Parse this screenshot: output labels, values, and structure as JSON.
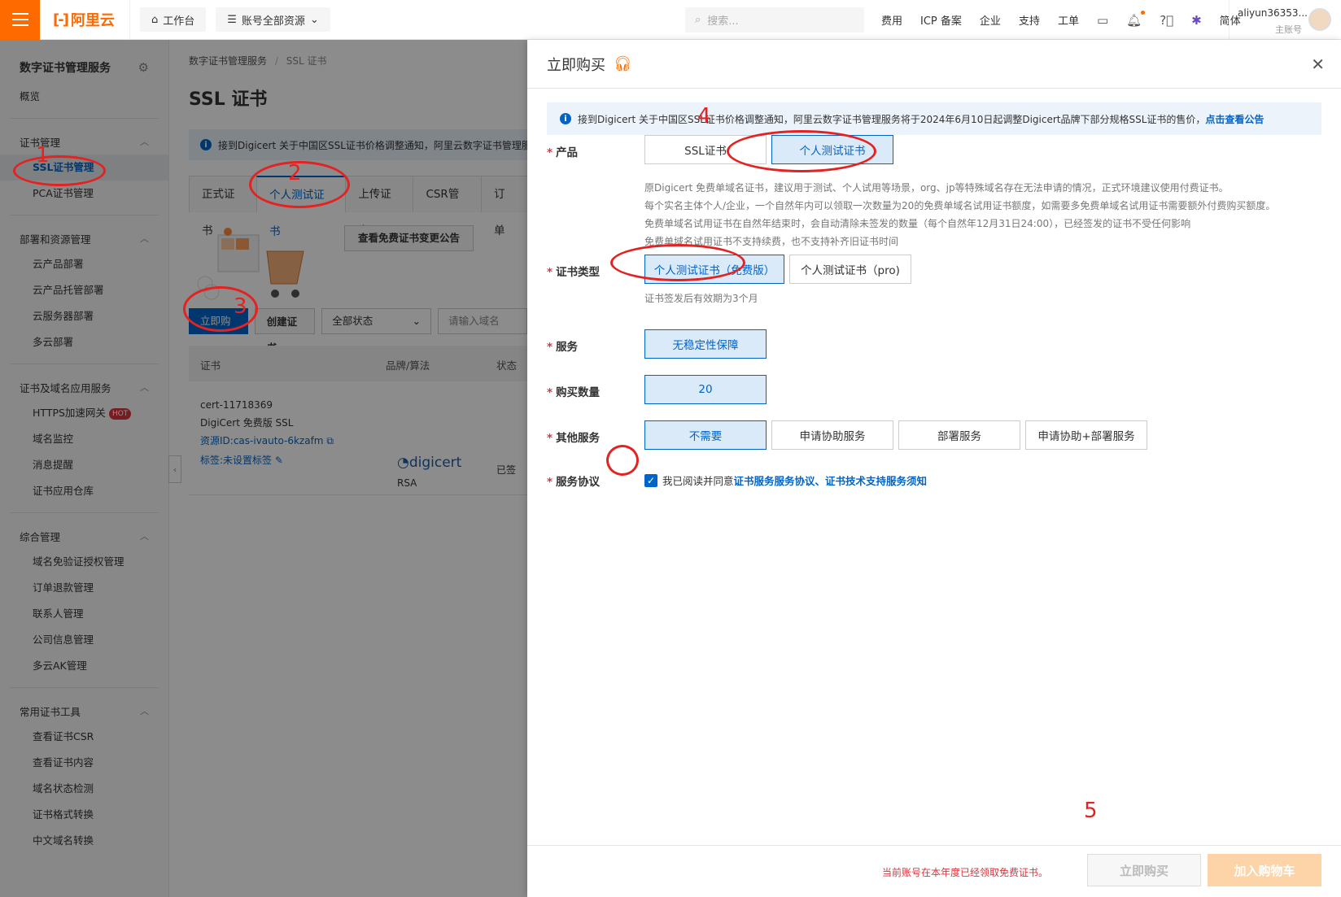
{
  "topbar": {
    "logo_text": "阿里云",
    "workbench": "工作台",
    "resources": "账号全部资源",
    "search_placeholder": "搜索...",
    "nav": [
      "费用",
      "ICP 备案",
      "企业",
      "支持",
      "工单"
    ],
    "lang": "简体",
    "account_name": "aliyun36353...",
    "account_sub": "主账号"
  },
  "sidebar": {
    "title": "数字证书管理服务",
    "overview": "概览",
    "groups": [
      {
        "label": "证书管理",
        "items": [
          "SSL证书管理",
          "PCA证书管理"
        ]
      },
      {
        "label": "部署和资源管理",
        "items": [
          "云产品部署",
          "云产品托管部署",
          "云服务器部署",
          "多云部署"
        ]
      },
      {
        "label": "证书及域名应用服务",
        "items": [
          "HTTPS加速网关",
          "域名监控",
          "消息提醒",
          "证书应用仓库"
        ]
      },
      {
        "label": "综合管理",
        "items": [
          "域名免验证授权管理",
          "订单退款管理",
          "联系人管理",
          "公司信息管理",
          "多云AK管理"
        ]
      },
      {
        "label": "常用证书工具",
        "items": [
          "查看证书CSR",
          "查看证书内容",
          "域名状态检测",
          "证书格式转换",
          "中文域名转换"
        ]
      }
    ],
    "hot_badge": "HOT"
  },
  "main": {
    "breadcrumb_root": "数字证书管理服务",
    "breadcrumb_cur": "SSL 证书",
    "title": "SSL 证书",
    "notice": "接到Digicert 关于中国区SSL证书价格调整通知，阿里云数字证书管理服务",
    "tabs": [
      "正式证书",
      "个人测试证书",
      "上传证书",
      "CSR管理",
      "订单"
    ],
    "free_notice_btn": "查看免费证书变更公告",
    "buy_btn": "立即购买",
    "create_btn": "创建证书",
    "status_select": "全部状态",
    "domain_input": "请输入域名",
    "col_cert": "证书",
    "col_brand": "品牌/算法",
    "col_status": "状态",
    "row": {
      "name": "cert-11718369",
      "type": "DigiCert 免费版 SSL",
      "resource": "资源ID:cas-ivauto-6kzafm",
      "tag": "标签:未设置标签",
      "brand": "digicert",
      "algo": "RSA",
      "status": "已签"
    }
  },
  "drawer": {
    "title": "立即购买",
    "notice_text": "接到Digicert 关于中国区SSL证书价格调整通知，阿里云数字证书管理服务将于2024年6月10日起调整Digicert品牌下部分规格SSL证书的售价，",
    "notice_link": "点击查看公告",
    "product_label": "产品",
    "product_opts": [
      "SSL证书",
      "个人测试证书"
    ],
    "help_lines": [
      "原Digicert 免费单域名证书，建议用于测试、个人试用等场景，org、jp等特殊域名存在无法申请的情况，正式环境建议使用付费证书。",
      "每个实名主体个人/企业，一个自然年内可以领取一次数量为20的免费单域名试用证书额度，如需要多免费单域名试用证书需要额外付费购买额度。",
      "免费单域名试用证书在自然年结束时，会自动清除未签发的数量（每个自然年12月31日24:00），已经签发的证书不受任何影响",
      "免费单域名试用证书不支持续费，也不支持补齐旧证书时间"
    ],
    "type_label": "证书类型",
    "type_opts": [
      "个人测试证书（免费版）",
      "个人测试证书（pro)"
    ],
    "type_help": "证书签发后有效期为3个月",
    "service_label": "服务",
    "service_opt": "无稳定性保障",
    "qty_label": "购买数量",
    "qty_value": "20",
    "other_label": "其他服务",
    "other_opts": [
      "不需要",
      "申请协助服务",
      "部署服务",
      "申请协助+部署服务"
    ],
    "agreement_label": "服务协议",
    "agree_prefix": "我已阅读并同意",
    "agree_link1": "证书服务服务协议",
    "agree_sep": "、",
    "agree_link2": "证书技术支持服务须知",
    "foot_warn": "当前账号在本年度已经领取免费证书。",
    "buy_btn": "立即购买",
    "cart_btn": "加入购物车"
  },
  "annotations": [
    "1",
    "2",
    "3",
    "4",
    "5"
  ],
  "colors": {
    "brand": "#ff6a00",
    "primary": "#0064c8",
    "annotation": "#e32222"
  }
}
